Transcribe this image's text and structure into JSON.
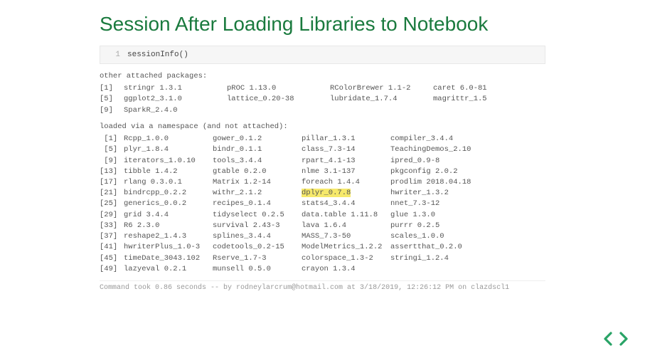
{
  "title": "Session After Loading Libraries to Notebook",
  "cell": {
    "lineno": "1",
    "code": "sessionInfo()"
  },
  "attached": {
    "heading": "other attached packages:",
    "rows": [
      {
        "idx": "[1]",
        "c0": "stringr 1.3.1",
        "c1": "pROC 1.13.0",
        "c2": "RColorBrewer 1.1-2",
        "c3": "caret 6.0-81"
      },
      {
        "idx": "[5]",
        "c0": "ggplot2_3.1.0",
        "c1": "lattice_0.20-38",
        "c2": "lubridate_1.7.4",
        "c3": "magrittr_1.5"
      },
      {
        "idx": "[9]",
        "c0": "SparkR_2.4.0",
        "c1": "",
        "c2": "",
        "c3": ""
      }
    ]
  },
  "loaded": {
    "heading": "loaded via a namespace (and not attached):",
    "rows": [
      {
        "idx": " [1]",
        "c0": "Rcpp_1.0.0",
        "c1": "gower_0.1.2",
        "c2": "pillar_1.3.1",
        "c3": "compiler_3.4.4"
      },
      {
        "idx": " [5]",
        "c0": "plyr_1.8.4",
        "c1": "bindr_0.1.1",
        "c2": "class_7.3-14",
        "c3": "TeachingDemos_2.10"
      },
      {
        "idx": " [9]",
        "c0": "iterators_1.0.10",
        "c1": "tools_3.4.4",
        "c2": "rpart_4.1-13",
        "c3": "ipred_0.9-8"
      },
      {
        "idx": "[13]",
        "c0": "tibble 1.4.2",
        "c1": "gtable 0.2.0",
        "c2": "nlme 3.1-137",
        "c3": "pkgconfig 2.0.2"
      },
      {
        "idx": "[17]",
        "c0": "rlang 0.3.0.1",
        "c1": "Matrix 1.2-14",
        "c2": "foreach 1.4.4",
        "c3": "prodlim 2018.04.18"
      },
      {
        "idx": "[21]",
        "c0": "bindrcpp_0.2.2",
        "c1": "withr_2.1.2",
        "c2": "dplyr_0.7.8",
        "c3": "hwriter_1.3.2",
        "hl": 2
      },
      {
        "idx": "[25]",
        "c0": "generics_0.0.2",
        "c1": "recipes_0.1.4",
        "c2": "stats4_3.4.4",
        "c3": "nnet_7.3-12"
      },
      {
        "idx": "[29]",
        "c0": "grid 3.4.4",
        "c1": "tidyselect 0.2.5",
        "c2": "data.table 1.11.8",
        "c3": "glue 1.3.0"
      },
      {
        "idx": "[33]",
        "c0": "R6 2.3.0",
        "c1": "survival 2.43-3",
        "c2": "lava 1.6.4",
        "c3": "purrr 0.2.5"
      },
      {
        "idx": "[37]",
        "c0": "reshape2_1.4.3",
        "c1": "splines_3.4.4",
        "c2": "MASS_7.3-50",
        "c3": "scales_1.0.0"
      },
      {
        "idx": "[41]",
        "c0": "hwriterPlus_1.0-3",
        "c1": "codetools_0.2-15",
        "c2": "ModelMetrics_1.2.2",
        "c3": "assertthat_0.2.0"
      },
      {
        "idx": "[45]",
        "c0": "timeDate_3043.102",
        "c1": "Rserve_1.7-3",
        "c2": "colorspace_1.3-2",
        "c3": "stringi_1.2.4"
      },
      {
        "idx": "[49]",
        "c0": "lazyeval 0.2.1",
        "c1": "munsell 0.5.0",
        "c2": "crayon 1.3.4",
        "c3": ""
      }
    ]
  },
  "footer": "Command took 0.86 seconds -- by rodneylarcrum@hotmail.com at 3/18/2019, 12:26:12 PM on clazdscl1"
}
